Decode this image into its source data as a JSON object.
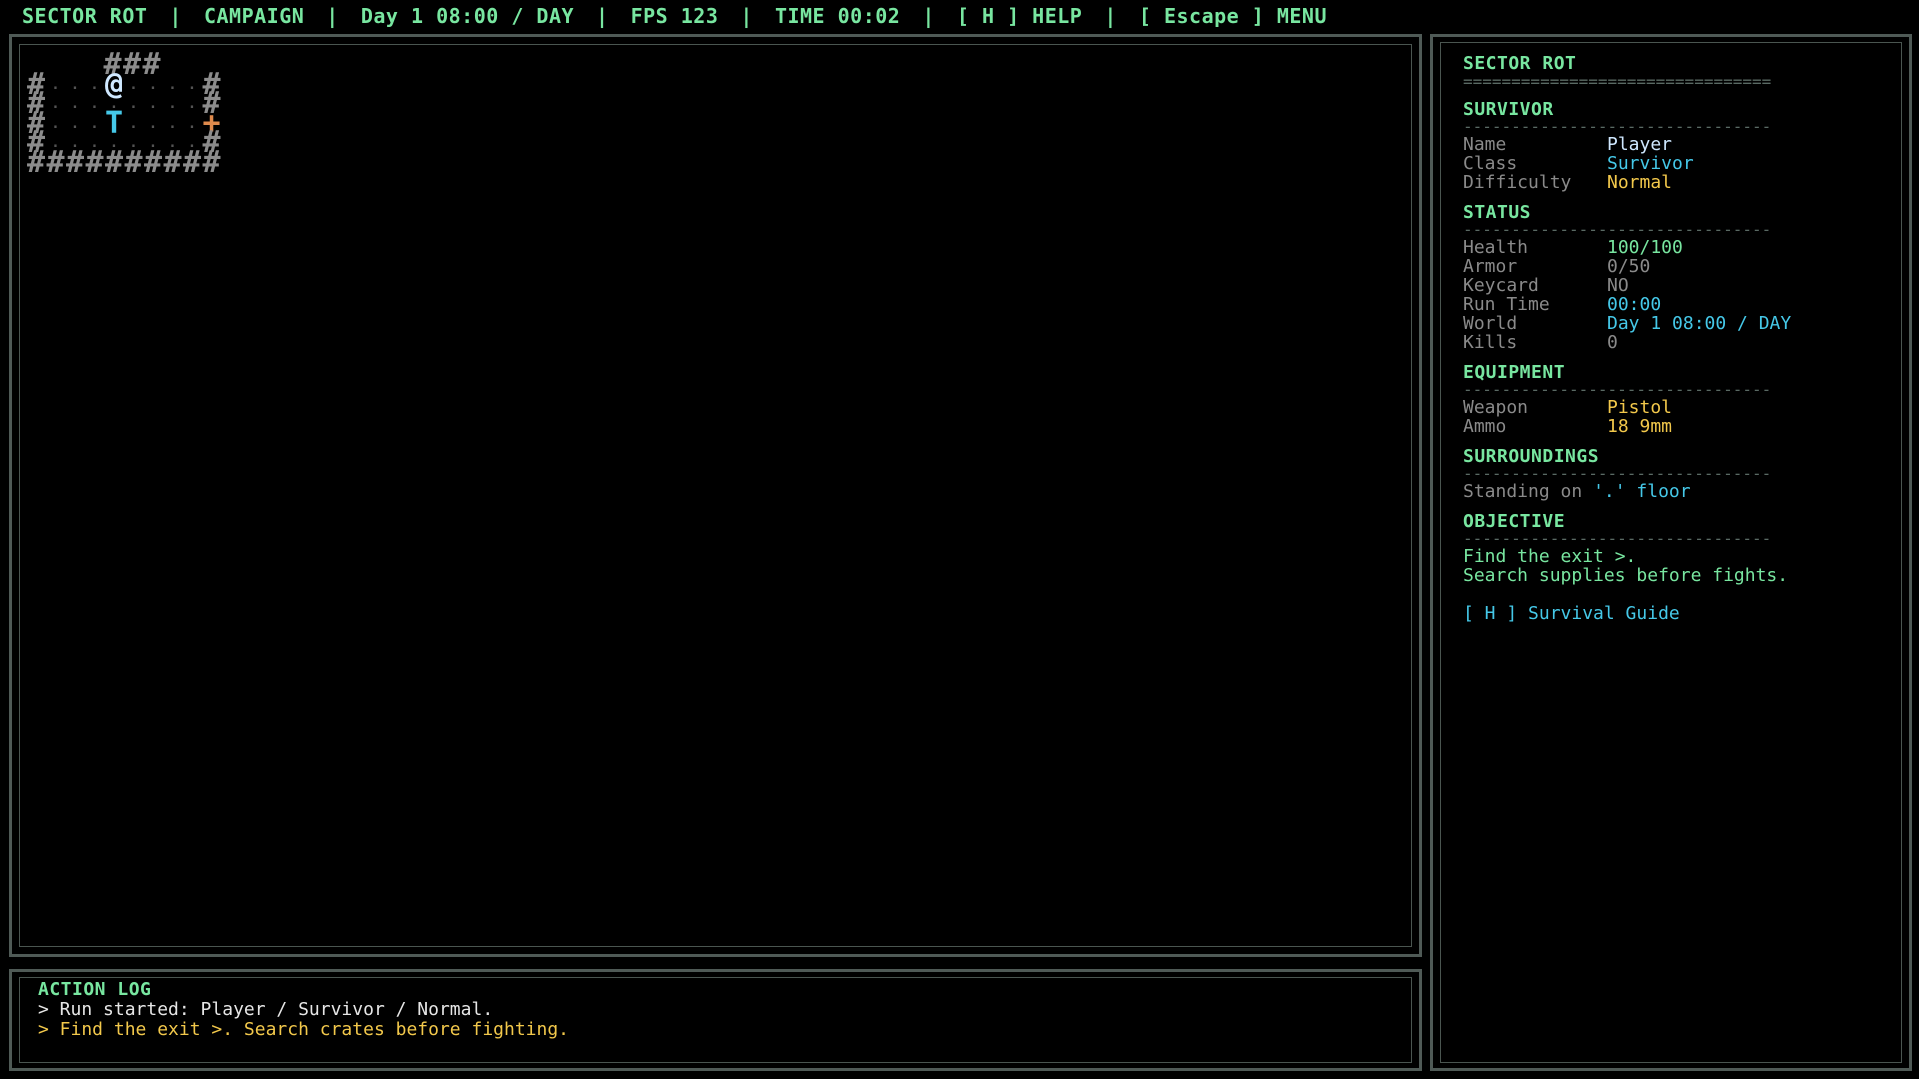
{
  "topbar": {
    "game": "SECTOR ROT",
    "mode": "CAMPAIGN",
    "world_time": "Day 1 08:00 / DAY",
    "fps": "FPS 123",
    "timer": "TIME 00:02",
    "help": "[ H ] HELP",
    "menu": "[ Escape ] MENU"
  },
  "map": {
    "wall_glyph": "#",
    "floor_glyph": ".",
    "player_glyph": "@",
    "terminal_glyph": "T",
    "door_glyph": "+"
  },
  "log": {
    "title": "ACTION LOG",
    "lines": [
      "> Run started: Player / Survivor / Normal.",
      "> Find the exit >. Search crates before fighting."
    ]
  },
  "side": {
    "title": "SECTOR ROT",
    "double_rule": "================================",
    "rule": "--------------------------------",
    "survivor": {
      "title": "SURVIVOR",
      "name_label": "Name",
      "name": "Player",
      "class_label": "Class",
      "class": "Survivor",
      "difficulty_label": "Difficulty",
      "difficulty": "Normal"
    },
    "status": {
      "title": "STATUS",
      "health_label": "Health",
      "health": "100/100",
      "armor_label": "Armor",
      "armor": "0/50",
      "keycard_label": "Keycard",
      "keycard": "NO",
      "runtime_label": "Run Time",
      "runtime": "00:00",
      "world_label": "World",
      "world": "Day 1 08:00 / DAY",
      "kills_label": "Kills",
      "kills": "0"
    },
    "equipment": {
      "title": "EQUIPMENT",
      "weapon_label": "Weapon",
      "weapon": "Pistol",
      "ammo_label": "Ammo",
      "ammo": "18 9mm"
    },
    "surroundings": {
      "title": "SURROUNDINGS",
      "standing_prefix": "Standing on",
      "standing_value": "'.' floor"
    },
    "objective": {
      "title": "OBJECTIVE",
      "line1": "Find the exit >.",
      "line2": "Search supplies before fights."
    },
    "guide": "[ H ] Survival Guide"
  },
  "colors": {
    "accent_green": "#78e6a0",
    "cyan": "#45c8e8",
    "yellow": "#f2c84b",
    "wall": "#8c8c8c",
    "door": "#e08a4c",
    "border": "#4f5a56"
  }
}
